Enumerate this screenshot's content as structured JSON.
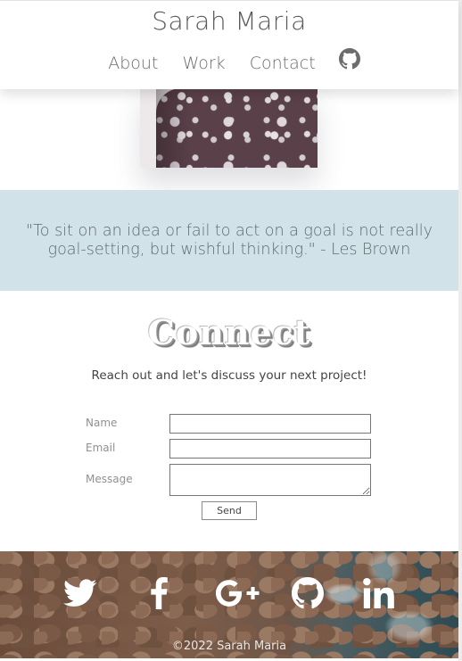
{
  "header": {
    "site_title": "Sarah Maria",
    "nav": [
      {
        "label": "About"
      },
      {
        "label": "Work"
      },
      {
        "label": "Contact"
      }
    ],
    "nav_icon": "github-icon"
  },
  "quote": {
    "text": "\"To sit on an idea or fail to act on a goal is not really goal-setting, but wishful thinking.\" - Les Brown"
  },
  "connect": {
    "heading": "Connect",
    "subheading": "Reach out and let's discuss your next project!",
    "form": {
      "name_label": "Name",
      "email_label": "Email",
      "message_label": "Message",
      "name_value": "",
      "email_value": "",
      "message_value": "",
      "send_label": "Send"
    }
  },
  "footer": {
    "social_icons": [
      "twitter-icon",
      "facebook-icon",
      "google-plus-icon",
      "github-icon",
      "linkedin-icon"
    ],
    "copyright": "©2022 Sarah Maria"
  },
  "colors": {
    "quote_band": "#d1e3e8",
    "text_primary": "#5a5a5a"
  }
}
